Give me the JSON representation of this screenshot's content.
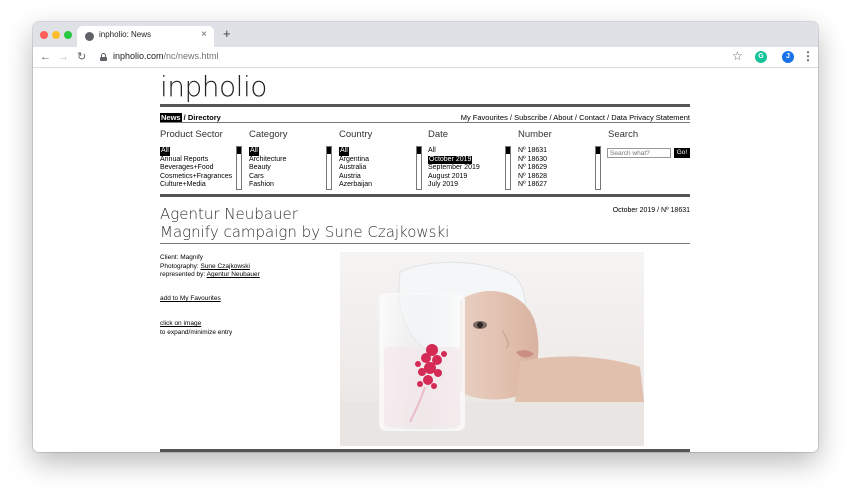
{
  "browser": {
    "tab_title": "inpholio: News",
    "new_tab": "+",
    "tab_close": "×",
    "url_domain": "inpholio.com",
    "url_path": "/nc/news.html",
    "avatar_letter": "J",
    "extension_letter": "G"
  },
  "site": {
    "logo": "inpholio",
    "nav_left_active": "News",
    "nav_left_sep": " / ",
    "nav_left_other": "Directory",
    "nav_right": "My Favourites / Subscribe / About / Contact / Data Privacy Statement"
  },
  "filters": {
    "product_sector": {
      "heading": "Product Sector",
      "items": [
        "All",
        "Annual Reports",
        "Beverages+Food",
        "Cosmetics+Fragrances",
        "Culture+Media"
      ],
      "selected": "All"
    },
    "category": {
      "heading": "Category",
      "items": [
        "All",
        "Architecture",
        "Beauty",
        "Cars",
        "Fashion"
      ],
      "selected": "All"
    },
    "country": {
      "heading": "Country",
      "items": [
        "All",
        "Argentina",
        "Australia",
        "Austria",
        "Azerbaijan"
      ],
      "selected": "All"
    },
    "date": {
      "heading": "Date",
      "items": [
        "All",
        "October 2019",
        "September 2019",
        "August 2019",
        "July 2019"
      ],
      "selected": "October 2019"
    },
    "number": {
      "heading": "Number",
      "items": [
        "Nº 18631",
        "Nº 18630",
        "Nº 18629",
        "Nº 18628",
        "Nº 18627"
      ]
    },
    "search": {
      "heading": "Search",
      "placeholder": "Search what?",
      "button": "Go!"
    }
  },
  "entry": {
    "title_line1": "Agentur Neubauer",
    "title_line2": "Magnify campaign by Sune Czajkowski",
    "date_number": "October 2019 / Nº 18631",
    "client_label": "Client: ",
    "client": "Magnify",
    "photography_label": "Photography: ",
    "photographer": "Sune Czajkowski",
    "represented_label": "represented by: ",
    "agency": "Agentur Neubauer",
    "add_favourites": "add to My Favourites",
    "click_image": "click on image",
    "expand_text": "to expand/minimize entry"
  }
}
